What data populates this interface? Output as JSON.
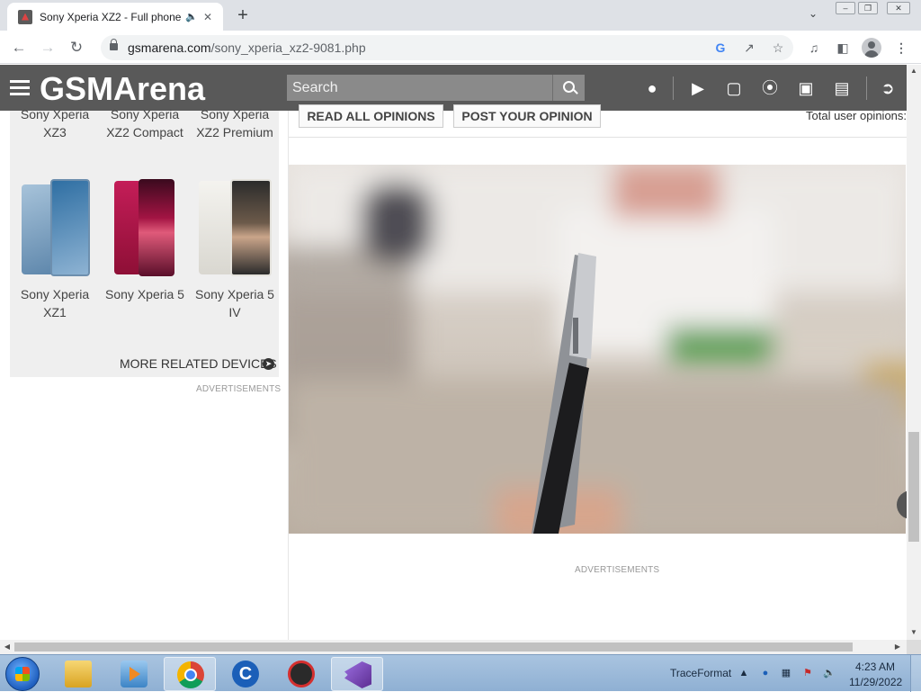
{
  "browser": {
    "tab_title": "Sony Xperia XZ2 - Full phone",
    "audio_icon": "speaker-icon",
    "url_domain": "gsmarena.com",
    "url_path": "/sony_xperia_xz2-9081.php"
  },
  "site": {
    "logo": "GSMArena",
    "search_placeholder": "Search",
    "header_icons": [
      "tip-icon",
      "youtube-icon",
      "instagram-icon",
      "rss-icon",
      "car-icon",
      "cart-icon",
      "logout-icon"
    ]
  },
  "related": {
    "row1": [
      {
        "name": "Sony Xperia XZ3"
      },
      {
        "name": "Sony Xperia XZ2 Compact"
      },
      {
        "name": "Sony Xperia XZ2 Premium"
      }
    ],
    "row2": [
      {
        "name": "Sony Xperia XZ1",
        "color": "#7fa7c9"
      },
      {
        "name": "Sony Xperia 5",
        "color": "#b0194a"
      },
      {
        "name": "Sony Xperia 5 IV",
        "color": "#e9e7e2"
      }
    ],
    "more_label": "MORE RELATED DEVICES",
    "ads_label": "ADVERTISEMENTS"
  },
  "opinions": {
    "read_all": "READ ALL OPINIONS",
    "post": "POST YOUR OPINION",
    "total_label": "Total user opinions:"
  },
  "main": {
    "ads_label": "ADVERTISEMENTS"
  },
  "taskbar": {
    "tray_label": "TraceFormat",
    "time": "4:23 AM",
    "date": "11/29/2022",
    "apps": [
      "explorer-icon",
      "media-player-icon",
      "chrome-icon",
      "ccleaner-icon",
      "app-gear-icon",
      "visual-studio-icon"
    ]
  }
}
